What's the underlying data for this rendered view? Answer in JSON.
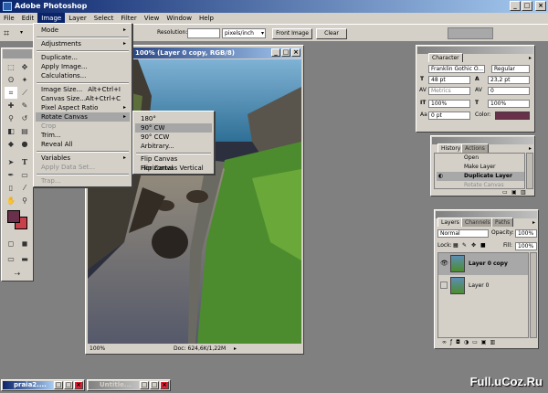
{
  "window": {
    "title": "Adobe Photoshop"
  },
  "menubar": {
    "items": [
      "File",
      "Edit",
      "Image",
      "Layer",
      "Select",
      "Filter",
      "View",
      "Window",
      "Help"
    ]
  },
  "options": {
    "resolution_label": "Resolution:",
    "units": "pixels/inch",
    "front_image": "Front Image",
    "clear": "Clear"
  },
  "document": {
    "title": "100% (Layer 0 copy, RGB/8)",
    "zoom": "100%",
    "doc_size": "Doc: 624,6K/1,22M"
  },
  "image_menu": {
    "items": [
      {
        "label": "Mode",
        "submenu": true
      },
      {
        "label": "Adjustments",
        "submenu": true
      },
      {
        "label": "Duplicate..."
      },
      {
        "label": "Apply Image..."
      },
      {
        "label": "Calculations..."
      },
      {
        "label": "Image Size...",
        "shortcut": "Alt+Ctrl+I"
      },
      {
        "label": "Canvas Size...",
        "shortcut": "Alt+Ctrl+C"
      },
      {
        "label": "Pixel Aspect Ratio",
        "submenu": true
      },
      {
        "label": "Rotate Canvas",
        "submenu": true
      },
      {
        "label": "Crop"
      },
      {
        "label": "Trim..."
      },
      {
        "label": "Reveal All"
      },
      {
        "label": "Variables",
        "submenu": true
      },
      {
        "label": "Apply Data Set..."
      },
      {
        "label": "Trap..."
      }
    ]
  },
  "rotate_menu": {
    "items": [
      "180°",
      "90° CW",
      "90° CCW",
      "Arbitrary...",
      "Flip Canvas Horizontal",
      "Flip Canvas Vertical"
    ]
  },
  "character_panel": {
    "tab": "Character",
    "font_family": "Franklin Gothic O...",
    "font_style": "Regular",
    "font_size": "48 pt",
    "leading": "23,2 pt",
    "kerning": "Metrics",
    "tracking": "0",
    "vscale": "100%",
    "hscale": "100%",
    "baseline": "0 pt",
    "color_label": "Color:",
    "color": "#6a2f4a"
  },
  "history_panel": {
    "tabs": [
      "History",
      "Actions"
    ],
    "items": [
      "Open",
      "Make Layer",
      "Duplicate Layer",
      "Rotate Canvas"
    ]
  },
  "layers_panel": {
    "tabs": [
      "Layers",
      "Channels",
      "Paths"
    ],
    "blend_mode": "Normal",
    "opacity_label": "Opacity:",
    "opacity": "100%",
    "lock_label": "Lock:",
    "fill_label": "Fill:",
    "fill": "100%",
    "layers": [
      "Layer 0 copy",
      "Layer 0"
    ]
  },
  "taskbar": {
    "items": [
      "praia2....",
      "Untitle..."
    ]
  },
  "watermark": "Full.uCoz.Ru",
  "colors": {
    "foreground": "#6a2f4a",
    "background": "#c8404a",
    "titlebar": "#0a246a"
  }
}
